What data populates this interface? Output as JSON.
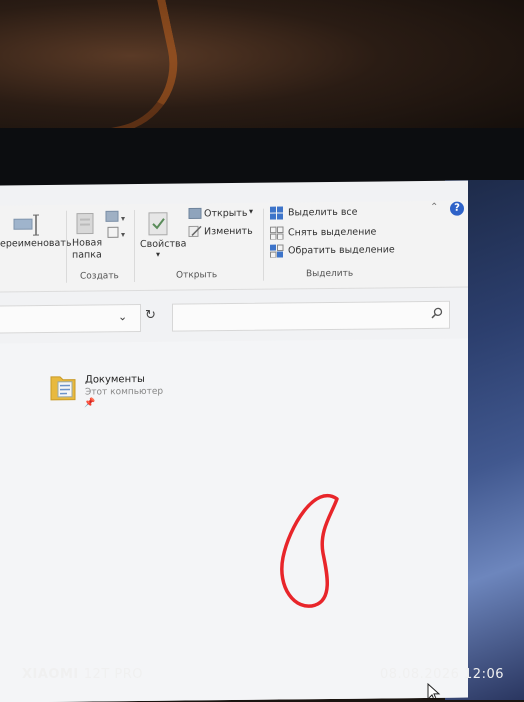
{
  "ribbon": {
    "rename_label": "ереименовать",
    "new_folder_label_1": "Новая",
    "new_folder_label_2": "папка",
    "create_group": "Создать",
    "properties_label": "Свойства",
    "open_label": "Открыть",
    "edit_label": "Изменить",
    "open_group": "Открыть",
    "select_all_label": "Выделить все",
    "deselect_label": "Снять выделение",
    "invert_selection_label": "Обратить выделение",
    "select_group": "Выделить",
    "help_label": "?"
  },
  "address_bar": {
    "chevron": "⌄",
    "refresh": "↻"
  },
  "search": {
    "placeholder": ""
  },
  "file_list": [
    {
      "name": "Документы",
      "location": "Этот компьютер",
      "pinned": true,
      "icon": "documents-folder-icon"
    }
  ],
  "annotation": {
    "color": "#e8252a"
  },
  "watermark": {
    "brand": "XIAOMI",
    "model": "12T PRO",
    "datetime": "08.08.2026 12:06"
  },
  "colors": {
    "accent": "#2e62c8",
    "window_bg": "#f1f2f4",
    "annotation": "#e8252a"
  }
}
